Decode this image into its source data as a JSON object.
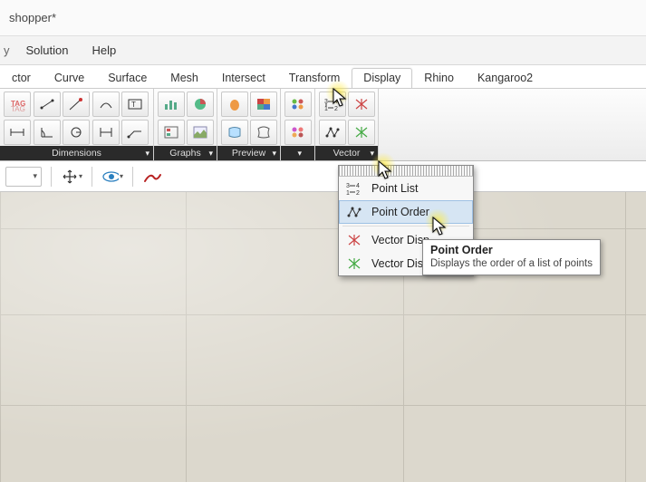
{
  "titlebar": {
    "title": "shopper*"
  },
  "menubar": {
    "items": [
      "",
      "Solution",
      "Help"
    ],
    "first_cut": "y"
  },
  "tabs": {
    "items": [
      "ctor",
      "Curve",
      "Surface",
      "Mesh",
      "Intersect",
      "Transform",
      "Display",
      "Rhino",
      "Kangaroo2"
    ],
    "active_index": 6
  },
  "ribbon": {
    "panels": [
      {
        "label": "Dimensions",
        "cols": 5
      },
      {
        "label": "Graphs",
        "cols": 2
      },
      {
        "label": "Preview",
        "cols": 2
      },
      {
        "label": "",
        "cols": 1
      },
      {
        "label": "Vector",
        "cols": 2
      }
    ]
  },
  "toolbar": {
    "select_chev": "▾",
    "move_chev": "▾",
    "eye_chev": "▾"
  },
  "popup": {
    "items": [
      {
        "label": "Point List",
        "icon": "order"
      },
      {
        "label": "Point Order",
        "icon": "path",
        "hover": true
      }
    ],
    "items2": [
      {
        "label": "Vector Disp",
        "icon": "burst-red"
      },
      {
        "label": "Vector Display Ex",
        "icon": "burst-green"
      }
    ]
  },
  "tooltip": {
    "title": "Point Order",
    "body": "Displays the order of a list of points"
  },
  "colors": {
    "canvas": "#dcd8cd"
  }
}
